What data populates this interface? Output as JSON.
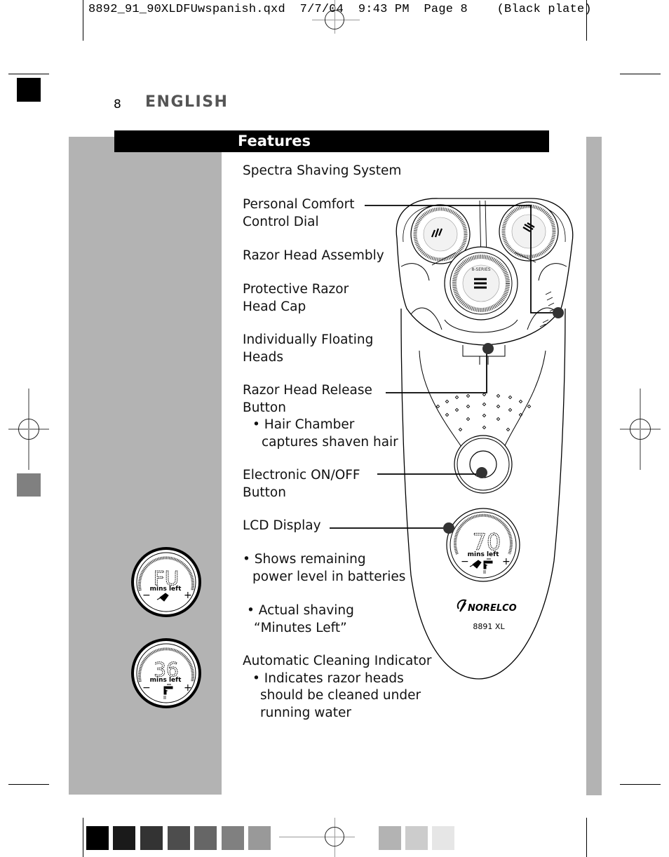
{
  "slug": {
    "filename": "8892_91_90XLDFUwspanish.qxd",
    "date": "7/7/04",
    "time": "9:43 PM",
    "page": "Page 8",
    "plate": "(Black plate)"
  },
  "page_header": {
    "page_number": "8",
    "language": "ENGLISH"
  },
  "section": {
    "title": "Features"
  },
  "features": [
    {
      "label": "Spectra Shaving System"
    },
    {
      "label": "Personal Comfort",
      "line2": "Control Dial"
    },
    {
      "label": "Razor Head Assembly"
    },
    {
      "label": "Protective Razor",
      "line2": "Head Cap"
    },
    {
      "label": "Individually Floating",
      "line2": "Heads"
    },
    {
      "label": "Razor Head Release",
      "line2": "Button",
      "bullet": "• Hair Chamber",
      "bullet_cont": "captures shaven hair"
    },
    {
      "label": "Electronic ON/OFF",
      "line2": "Button"
    },
    {
      "label": "LCD Display"
    },
    {
      "bullet": "• Shows remaining",
      "bullet_cont": "power level in batteries"
    },
    {
      "bullet": "• Actual shaving",
      "bullet_cont": "“Minutes Left”"
    },
    {
      "label": "Automatic Cleaning Indicator",
      "bullet": "• Indicates razor heads",
      "bullet_cont": "should be cleaned under",
      "bullet_cont2": "running water"
    }
  ],
  "lcd_displays": {
    "main": {
      "digits": "70",
      "caption": "mins left",
      "minus": "−",
      "plus": "+"
    },
    "full_charge": {
      "digits": "FU",
      "caption": "mins left",
      "minus": "−",
      "plus": "+"
    },
    "cleaning": {
      "digits": "36",
      "caption": "mins left",
      "minus": "−",
      "plus": "+"
    }
  },
  "product": {
    "brand": "NORELCO",
    "model": "8891 XL",
    "head_marking": "8-SERIES"
  },
  "color_bar": {
    "swatches": [
      "#000000",
      "#1a1a1a",
      "#333333",
      "#4d4d4d",
      "#666666",
      "#808080",
      "#999999",
      "#b3b3b3",
      "#cccccc",
      "#e6e6e6"
    ]
  },
  "side_marks": {
    "top_left_square": "#000000",
    "mid_left_square": "#808080"
  }
}
